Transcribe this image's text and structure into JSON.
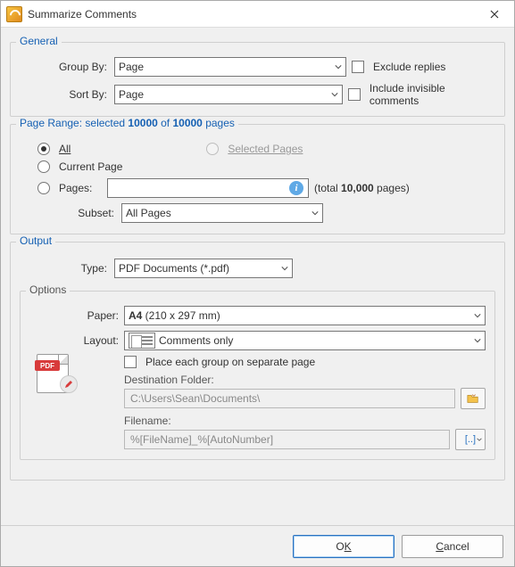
{
  "window": {
    "title": "Summarize Comments"
  },
  "general": {
    "legend": "General",
    "group_by_label": "Group By:",
    "group_by_value": "Page",
    "sort_by_label": "Sort By:",
    "sort_by_value": "Page",
    "exclude_replies_label": "Exclude replies",
    "include_invisible_label": "Include invisible comments"
  },
  "page_range": {
    "legend_prefix": "Page Range: selected ",
    "selected": "10000",
    "legend_mid": " of ",
    "total": "10000",
    "legend_suffix": " pages",
    "all_label": "All",
    "selected_pages_label": "Selected Pages",
    "current_page_label": "Current Page",
    "pages_label": "Pages:",
    "pages_value": "",
    "total_hint_prefix": "(total ",
    "total_hint_value": "10,000",
    "total_hint_suffix": " pages)",
    "subset_label": "Subset:",
    "subset_value": "All Pages"
  },
  "output": {
    "legend": "Output",
    "type_label": "Type:",
    "type_value": "PDF Documents (*.pdf)",
    "options_legend": "Options",
    "paper_label": "Paper:",
    "paper_value_main": "A4",
    "paper_value_detail": " (210 x 297 mm)",
    "layout_label": "Layout:",
    "layout_value": "Comments only",
    "separate_page_label": "Place each group on separate page",
    "dest_folder_label": "Destination Folder:",
    "dest_folder_value": "C:\\Users\\Sean\\Documents\\",
    "filename_label": "Filename:",
    "filename_value": "%[FileName]_%[AutoNumber]",
    "pdf_badge": "PDF"
  },
  "footer": {
    "ok_prefix": "O",
    "ok_key": "K",
    "cancel_key": "C",
    "cancel_rest": "ancel"
  }
}
